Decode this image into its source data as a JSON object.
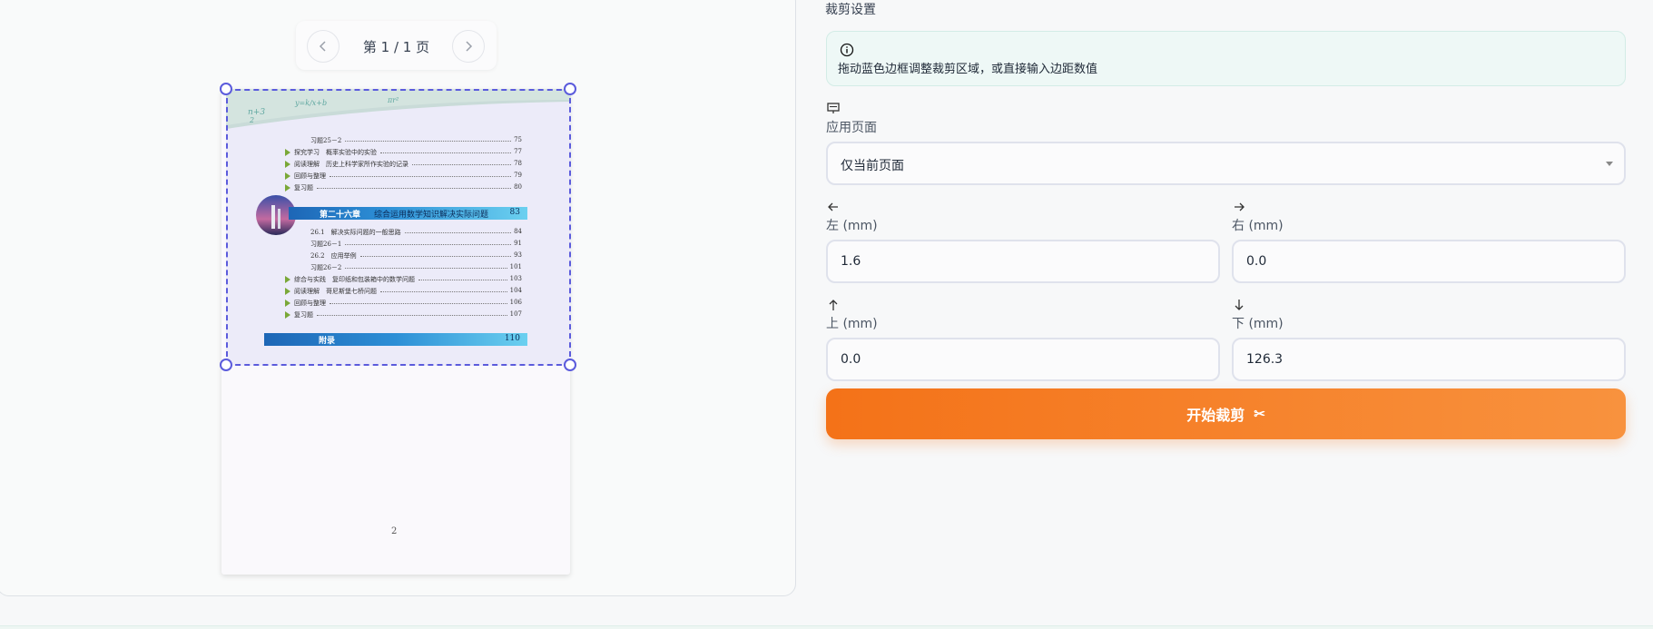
{
  "pager": {
    "label": "第 1 / 1 页"
  },
  "page_preview": {
    "toc_rows": [
      {
        "text": "习题25－2",
        "page": "75",
        "bullet": false
      },
      {
        "text": "探究学习　概率实验中的实验",
        "page": "77",
        "bullet": true
      },
      {
        "text": "阅读理解　历史上科学家所作实验的记录",
        "page": "78",
        "bullet": true
      },
      {
        "text": "回顾与整理",
        "page": "79",
        "bullet": true
      },
      {
        "text": "复习题",
        "page": "80",
        "bullet": true
      },
      {
        "text": "26.1　解决实际问题的一般思路",
        "page": "84",
        "bullet": false
      },
      {
        "text": "习题26－1",
        "page": "91",
        "bullet": false
      },
      {
        "text": "26.2　应用举例",
        "page": "93",
        "bullet": false
      },
      {
        "text": "习题26－2",
        "page": "101",
        "bullet": false
      },
      {
        "text": "综合与实践　复印纸和包装箱中的数学问题",
        "page": "103",
        "bullet": true
      },
      {
        "text": "阅读理解　哥尼斯堡七桥问题",
        "page": "104",
        "bullet": true
      },
      {
        "text": "回顾与整理",
        "page": "106",
        "bullet": true
      },
      {
        "text": "复习题",
        "page": "107",
        "bullet": true
      }
    ],
    "chapter": {
      "label": "第二十六章",
      "title": "综合运用数学知识解决实际问题",
      "page": "83"
    },
    "appendix": {
      "label": "附录",
      "page": "110"
    },
    "page_number": "2"
  },
  "settings": {
    "section_title": "裁剪设置",
    "info_text": "拖动蓝色边框调整裁剪区域，或直接输入边距数值",
    "apply_label": "应用页面",
    "apply_value": "仅当前页面",
    "left_label": "左 (mm)",
    "left_value": "1.6",
    "right_label": "右 (mm)",
    "right_value": "0.0",
    "top_label": "上 (mm)",
    "top_value": "0.0",
    "bottom_label": "下 (mm)",
    "bottom_value": "126.3",
    "crop_button_label": "开始裁剪"
  },
  "icons": {
    "prev": "chevron-left-icon",
    "next": "chevron-right-icon",
    "info": "info-circle-icon",
    "apply": "page-stack-icon",
    "left": "arrow-left-icon",
    "right": "arrow-right-icon",
    "up": "arrow-up-icon",
    "down": "arrow-down-icon",
    "scissors": "scissors-icon"
  },
  "colors": {
    "crop_frame": "#5b5bdc",
    "button_start": "#f47218",
    "button_end": "#f8923e",
    "info_bg": "#eef8f6"
  }
}
